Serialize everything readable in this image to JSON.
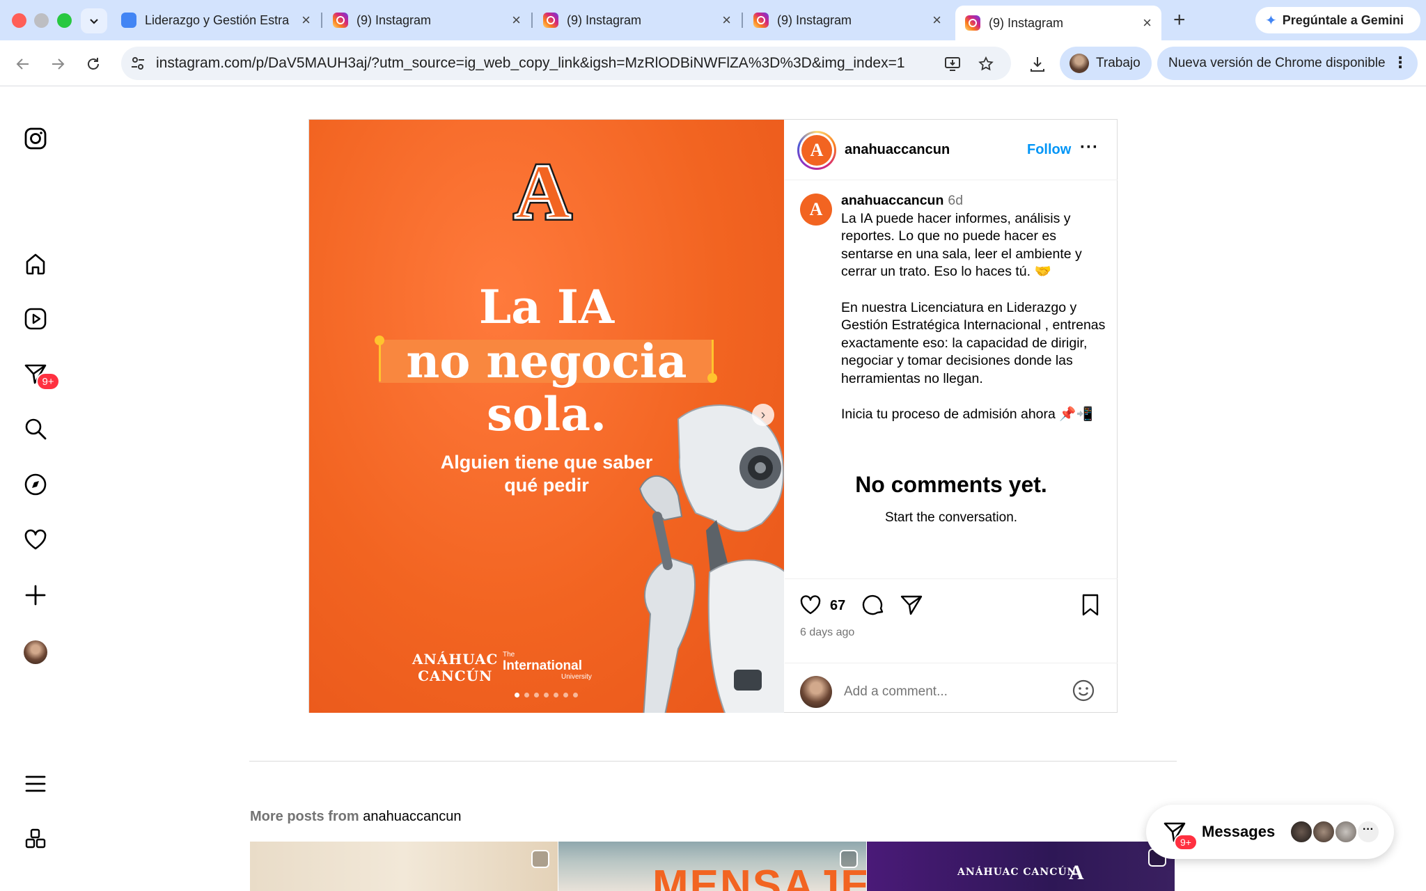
{
  "browser": {
    "tabs": [
      {
        "label": "Liderazgo y Gestión Estra",
        "favicon": "docs-icon"
      },
      {
        "label": "(9) Instagram",
        "favicon": "instagram-icon"
      },
      {
        "label": "(9) Instagram",
        "favicon": "instagram-icon"
      },
      {
        "label": "(9) Instagram",
        "favicon": "instagram-icon"
      },
      {
        "label": "(9) Instagram",
        "favicon": "instagram-icon",
        "active": true
      }
    ],
    "gemini_label": "Pregúntale a Gemini",
    "url": "instagram.com/p/DaV5MAUH3aj/?utm_source=ig_web_copy_link&igsh=MzRlODBiNWFlZA%3D%3D&img_index=1",
    "profile_label": "Trabajo",
    "update_label": "Nueva versión de Chrome disponible"
  },
  "sidebar": {
    "items": [
      "instagram-logo-icon",
      "home-icon",
      "reels-icon",
      "messages-icon",
      "search-icon",
      "explore-icon",
      "notifications-icon",
      "create-icon",
      "profile-avatar",
      "menu-icon",
      "more-icon"
    ],
    "messages_badge": "9+"
  },
  "post": {
    "image": {
      "logo_letter": "A",
      "headline_1": "La IA",
      "headline_2": "no negocia",
      "headline_3": "sola.",
      "subline_1": "Alguien tiene que saber",
      "subline_2": "qué pedir",
      "brand_1": "ANÁHUAC",
      "brand_2": "CANCÚN",
      "brand_the": "The",
      "brand_intl": "International",
      "brand_univ": "University",
      "carousel_count": 7,
      "carousel_index": 1
    },
    "header": {
      "username": "anahuaccancun",
      "follow_label": "Follow",
      "avatar_letter": "A"
    },
    "caption": {
      "username": "anahuaccancun",
      "time": "6d",
      "para1": "La IA puede hacer informes, análisis y reportes. Lo que no puede hacer es sentarse en una sala, leer el ambiente y cerrar un trato. Eso lo haces tú. 🤝",
      "para2": "En nuestra Licenciatura en Liderazgo y Gestión Estratégica Internacional , entrenas exactamente eso: la capacidad de dirigir, negociar y tomar decisiones donde las herramientas no llegan.",
      "para3": "Inicia tu proceso de admisión ahora 📌📲"
    },
    "comments_empty_title": "No comments yet.",
    "comments_empty_sub": "Start the conversation.",
    "likes": "67",
    "posted_ago": "6 days ago",
    "comment_placeholder": "Add a comment..."
  },
  "more_posts": {
    "prefix": "More posts from",
    "username": "anahuaccancun",
    "thumb2_text": "MENSAJE",
    "thumb3_text": "ANÁHUAC CANCÚN",
    "thumb3_logo": "A"
  },
  "messages_pill": {
    "label": "Messages",
    "badge": "9+"
  },
  "colors": {
    "instagram_blue": "#0095f6",
    "badge_red": "#ff3040",
    "brand_orange": "#f26421",
    "chrome_tabstrip": "#d3e3fd"
  }
}
